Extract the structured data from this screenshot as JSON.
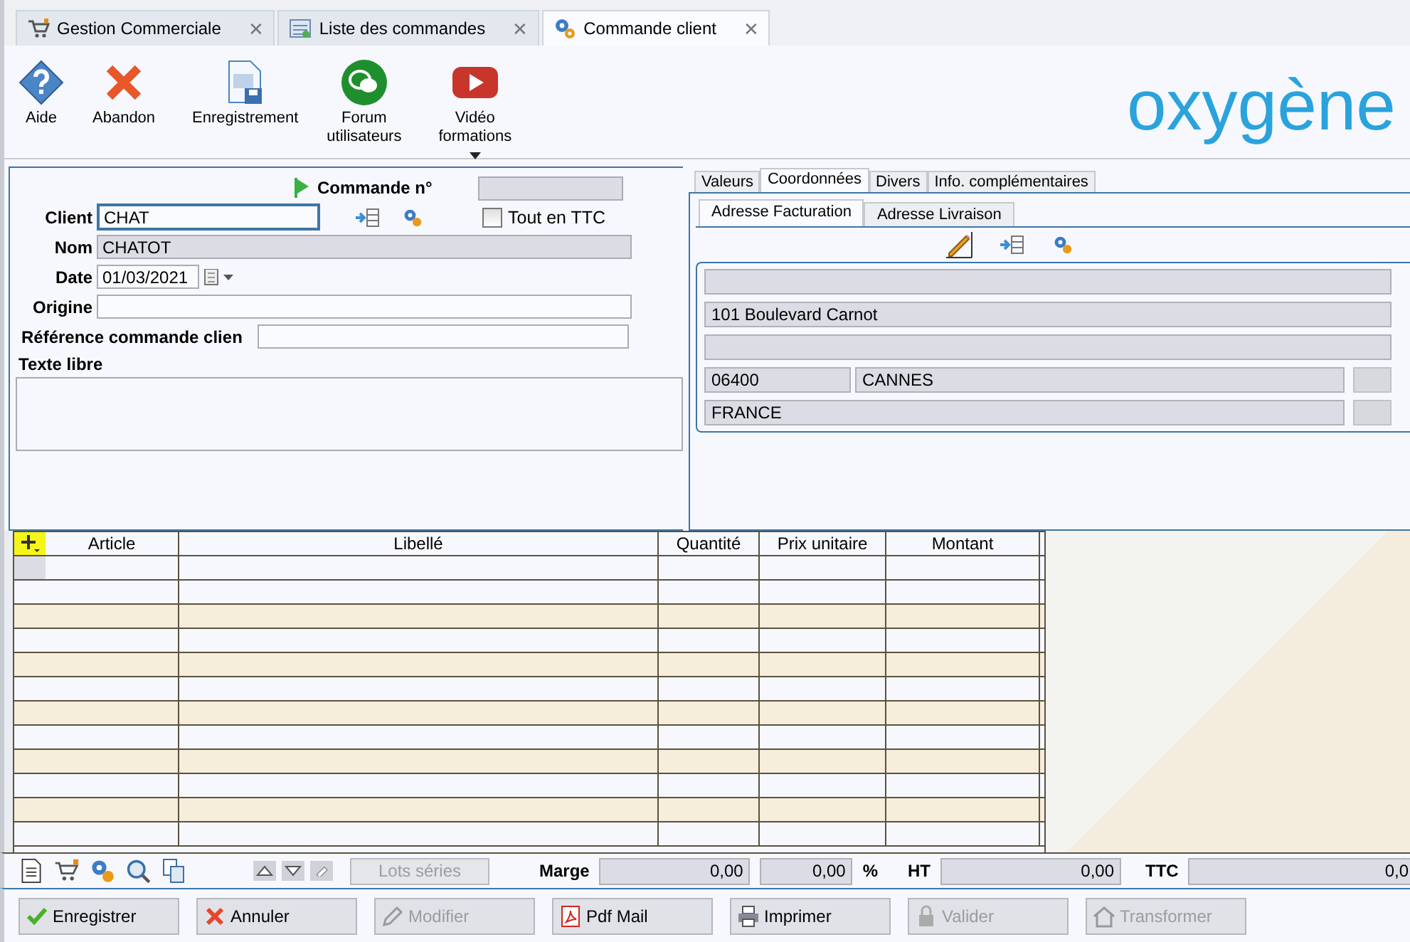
{
  "tabs": [
    {
      "label": "Gestion Commerciale",
      "close": "✕",
      "selected": false
    },
    {
      "label": "Liste des commandes",
      "close": "✕",
      "selected": false
    },
    {
      "label": "Commande client",
      "close": "✕",
      "selected": true
    }
  ],
  "toolbar": [
    {
      "lines": [
        "Aide"
      ],
      "has_menu": false
    },
    {
      "lines": [
        "Abandon"
      ],
      "has_menu": false
    },
    {
      "lines": [
        "Enregistrement"
      ],
      "has_menu": false
    },
    {
      "lines": [
        "Forum",
        "utilisateurs"
      ],
      "has_menu": false
    },
    {
      "lines": [
        "Vidéo",
        "formations"
      ],
      "has_menu": true
    }
  ],
  "logo": "oxygène",
  "form": {
    "order_label": "Commande n°",
    "client_label": "Client",
    "client": "CHAT",
    "ttc": {
      "label": "Tout en TTC",
      "checked": false
    },
    "nom_label": "Nom",
    "nom": "CHATOT",
    "date_label": "Date",
    "date": "01/03/2021",
    "origine_label": "Origine",
    "reference_label": "Référence commande clien",
    "texte_label": "Texte libre"
  },
  "detail_tabs": [
    {
      "label": "Valeurs",
      "selected": false
    },
    {
      "label": "Coordonnées",
      "selected": true
    },
    {
      "label": "Divers",
      "selected": false
    },
    {
      "label": "Info. complémentaires",
      "selected": false
    }
  ],
  "address_tabs": [
    {
      "label": "Adresse Facturation",
      "selected": true
    },
    {
      "label": "Adresse Livraison",
      "selected": false
    }
  ],
  "address": {
    "line_2": "101 Boulevard Carnot",
    "postcode": "06400",
    "city": "CANNES",
    "country": "FRANCE"
  },
  "grid": {
    "columns": [
      "Article",
      "Libellé",
      "Quantité",
      "Prix unitaire",
      "Montant"
    ]
  },
  "footer": {
    "lots": {
      "label": "Lots séries",
      "disabled": true
    },
    "marge_label": "Marge",
    "marge": "0,00",
    "marge_pct": "0,00",
    "pct_sign": "%",
    "ht_label": "HT",
    "ht": "0,00",
    "ttc_label": "TTC",
    "ttc": "0,0"
  },
  "buttons": [
    {
      "label": "Enregistrer",
      "disabled": false
    },
    {
      "label": "Annuler",
      "disabled": false
    },
    {
      "label": "Modifier",
      "disabled": true
    },
    {
      "label": "Pdf Mail",
      "disabled": false
    },
    {
      "label": "Imprimer",
      "disabled": false
    },
    {
      "label": "Valider",
      "disabled": true
    },
    {
      "label": "Transformer",
      "disabled": true
    }
  ]
}
